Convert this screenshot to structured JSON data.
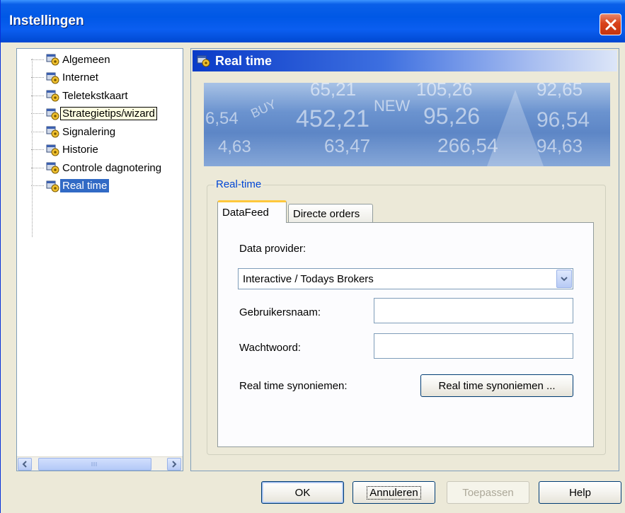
{
  "window": {
    "title": "Instellingen"
  },
  "tree": {
    "items": [
      {
        "label": "Algemeen",
        "state": "normal"
      },
      {
        "label": "Internet",
        "state": "normal"
      },
      {
        "label": "Teletekstkaart",
        "state": "normal"
      },
      {
        "label": "Strategietips/wizard",
        "state": "focus"
      },
      {
        "label": "Signalering",
        "state": "normal"
      },
      {
        "label": "Historie",
        "state": "normal"
      },
      {
        "label": "Controle dagnotering",
        "state": "normal"
      },
      {
        "label": "Real time",
        "state": "selected"
      }
    ]
  },
  "panel": {
    "title": "Real time",
    "banner_numbers": [
      "65,21",
      "105,26",
      "92,65",
      "452,21",
      "95,26",
      "96,54",
      "6,54",
      "63,47",
      "266,54",
      "94,63",
      "4,63",
      "NEW",
      "BUY"
    ]
  },
  "group": {
    "legend": "Real-time",
    "tabs": [
      {
        "label": "DataFeed",
        "active": true
      },
      {
        "label": "Directe orders",
        "active": false
      }
    ]
  },
  "datafeed": {
    "provider_label": "Data provider:",
    "provider_value": "Interactive / Todays Brokers",
    "username_label": "Gebruikersnaam:",
    "username_value": "",
    "password_label": "Wachtwoord:",
    "password_value": "",
    "synonyms_label": "Real time synoniemen:",
    "synonyms_button": "Real time synoniemen ..."
  },
  "buttons": {
    "ok": "OK",
    "cancel": "Annuleren",
    "apply": "Toepassen",
    "help": "Help"
  },
  "icons": {
    "close": "close-icon",
    "tree_item": "settings-gear-icon",
    "scroll_left": "arrow-left-icon",
    "scroll_right": "arrow-right-icon",
    "dropdown": "chevron-down-icon"
  },
  "colors": {
    "titlebar": "#0058e6",
    "close_button": "#d9421a",
    "selection": "#316ac5",
    "legend_text": "#0046d5",
    "active_tab_accent": "#ffc83c"
  }
}
